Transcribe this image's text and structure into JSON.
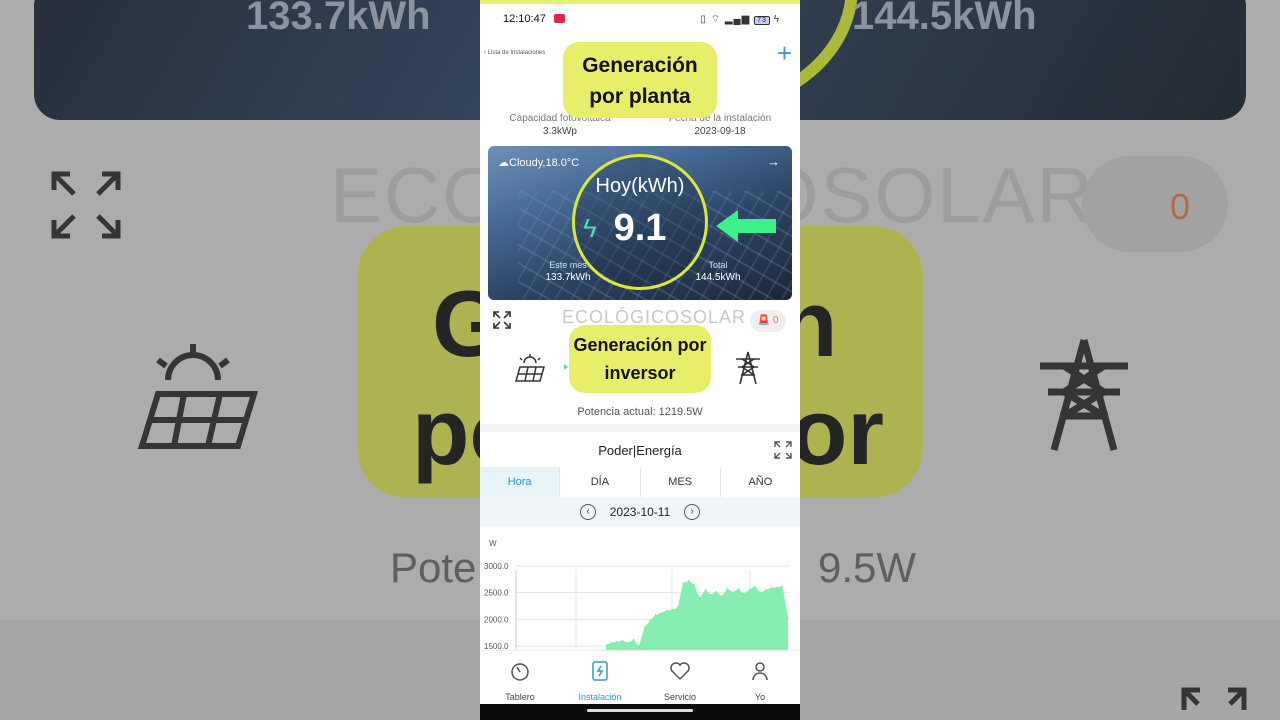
{
  "status_bar": {
    "time": "12:10:47",
    "battery": "73"
  },
  "header": {
    "back_label": "Lista de Instalaciones",
    "add_icon": "plus-icon"
  },
  "callouts": {
    "planta": "Generación por planta",
    "inversor": "Generación por inversor"
  },
  "plant_info": {
    "capacity_label": "Capacidad fotovoltaica",
    "capacity_value": "3.3kWp",
    "install_date_label": "Fecha de la instalación",
    "install_date_value": "2023-09-18"
  },
  "hero": {
    "weather": "Cloudy,18.0°C",
    "today_label": "Hoy(kWh)",
    "today_value": "9.1",
    "month_label": "Este mes",
    "month_value": "133.7kWh",
    "total_label": "Total",
    "total_value": "144.5kWh"
  },
  "brand": {
    "logo_text": "ECOLÓGICOSOLAR"
  },
  "alarm_count": "0",
  "flow": {
    "power_label": "Potencia actual:",
    "power_value": "1219.5W"
  },
  "chart_section": {
    "title": "Poder|Energía",
    "tabs": [
      "Hora",
      "DÍA",
      "MES",
      "AÑO"
    ],
    "active_tab": "Hora",
    "date": "2023-10-11"
  },
  "chart_data": {
    "type": "area",
    "ylabel": "W",
    "yticks": [
      1500.0,
      2000.0,
      2500.0,
      3000.0
    ],
    "ylim": [
      1500,
      3000
    ],
    "color": "#86eeb0",
    "x": [
      0,
      1,
      2,
      3,
      4,
      5,
      6,
      7,
      8,
      9,
      10,
      11,
      12,
      13,
      14,
      15,
      16,
      17,
      18,
      19,
      20,
      21,
      22,
      23,
      24,
      25,
      26,
      27,
      28,
      29,
      30,
      31,
      32,
      33
    ],
    "values": [
      1520,
      1560,
      1580,
      1600,
      1560,
      1620,
      1500,
      1850,
      1980,
      2080,
      2120,
      2160,
      2180,
      2220,
      2680,
      2720,
      2650,
      2400,
      2560,
      2460,
      2520,
      2430,
      2580,
      2510,
      2570,
      2480,
      2560,
      2620,
      2500,
      2550,
      2590,
      2600,
      2620,
      2030
    ]
  },
  "bottom_nav": [
    {
      "label": "Tablero",
      "icon": "dashboard-icon"
    },
    {
      "label": "Instalación",
      "icon": "plant-icon"
    },
    {
      "label": "Servicio",
      "icon": "service-icon"
    },
    {
      "label": "Yo",
      "icon": "user-icon"
    }
  ],
  "active_nav": "Instalación"
}
